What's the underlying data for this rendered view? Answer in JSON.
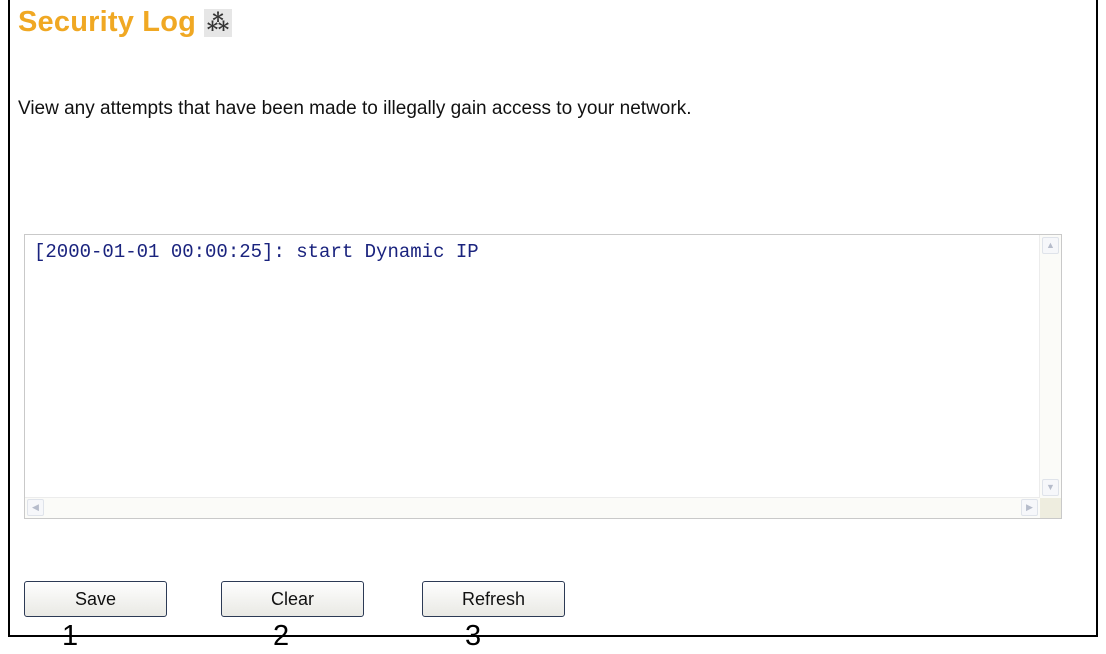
{
  "header": {
    "title": "Security Log",
    "help_icon": "help-icon"
  },
  "description": "View any attempts that have been made to illegally gain access to your network.",
  "log": {
    "entries": [
      "[2000-01-01 00:00:25]: start Dynamic IP"
    ]
  },
  "buttons": {
    "save_label": "Save",
    "clear_label": "Clear",
    "refresh_label": "Refresh"
  },
  "markers": [
    "1",
    "2",
    "3"
  ],
  "colors": {
    "title": "#f0a823",
    "log_text": "#1a237e",
    "button_border": "#2c3a55"
  }
}
